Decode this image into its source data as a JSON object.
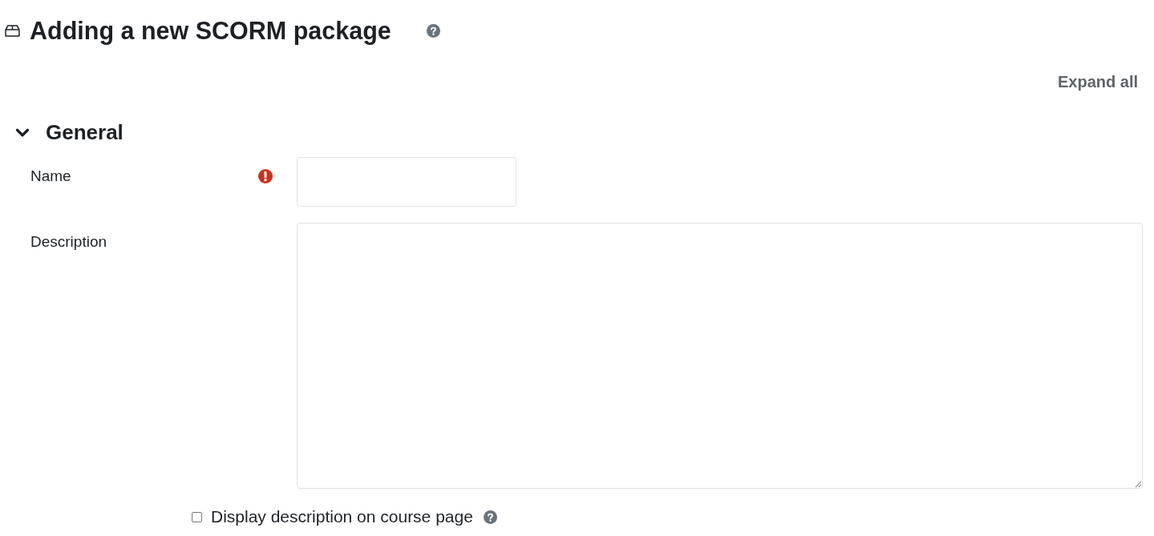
{
  "page": {
    "title": "Adding a new SCORM package",
    "help": true
  },
  "expand_all": "Expand all",
  "sections": [
    {
      "title": "General",
      "expanded": true,
      "fields": [
        {
          "kind": "text",
          "label": "Name",
          "required": true
        },
        {
          "kind": "textarea",
          "label": "Description",
          "required": false
        },
        {
          "kind": "checkbox",
          "label": "Display description on course page",
          "checked": false,
          "help": true
        }
      ]
    }
  ]
}
